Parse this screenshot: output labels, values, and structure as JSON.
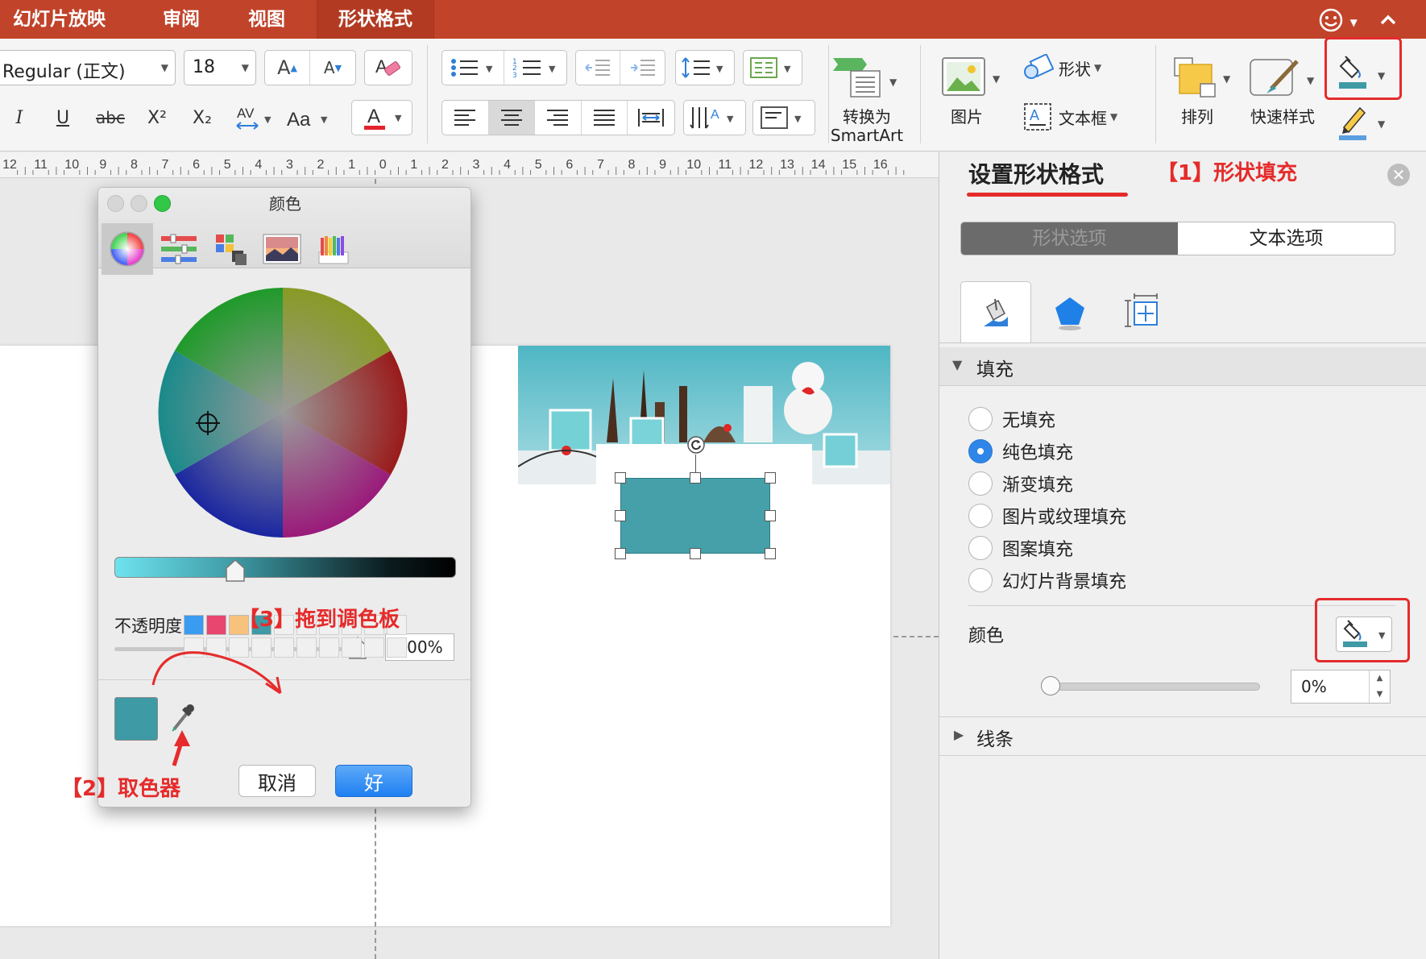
{
  "tabs": [
    {
      "label": "幻灯片放映",
      "active": false
    },
    {
      "label": "审阅",
      "active": false
    },
    {
      "label": "视图",
      "active": false
    },
    {
      "label": "形状格式",
      "active": true
    }
  ],
  "ribbon": {
    "font_name": "Regular (正文)",
    "font_size": "18",
    "convert_smartart": [
      "转换为",
      "SmartArt"
    ],
    "picture_label": "图片",
    "shape_label": "形状",
    "textbox_label": "文本框",
    "arrange_label": "排列",
    "quick_style_label": "快速样式",
    "format_labels": {
      "italic": "I",
      "underline": "U",
      "strike": "abc",
      "superscript": "X²",
      "subscript": "X₂"
    }
  },
  "ruler_ticks": [
    "12",
    "11",
    "10",
    "9",
    "8",
    "7",
    "6",
    "5",
    "4",
    "3",
    "2",
    "1",
    "0",
    "1",
    "2",
    "3",
    "4",
    "5",
    "6",
    "7",
    "8",
    "9",
    "10",
    "11",
    "12",
    "13",
    "14",
    "15",
    "16"
  ],
  "color_dialog": {
    "title": "颜色",
    "opacity_label": "不透明度",
    "opacity_value": "100%",
    "current_color": "#3e9aa5",
    "custom_swatches": [
      "#3a9cf0",
      "#e8466e",
      "#f7c27c",
      "#3e9aa5"
    ],
    "cancel_label": "取消",
    "ok_label": "好"
  },
  "selected_shape": {
    "fill_color": "#46a0aa"
  },
  "format_pane": {
    "title": "设置形状格式",
    "tabs": [
      "形状选项",
      "文本选项"
    ],
    "fill_section": "填充",
    "fill_options": [
      {
        "label": "无填充",
        "selected": false
      },
      {
        "label": "纯色填充",
        "selected": true
      },
      {
        "label": "渐变填充",
        "selected": false
      },
      {
        "label": "图片或纹理填充",
        "selected": false
      },
      {
        "label": "图案填充",
        "selected": false
      },
      {
        "label": "幻灯片背景填充",
        "selected": false
      }
    ],
    "color_label": "颜色",
    "transparency_value": "0%",
    "line_section": "线条"
  },
  "annotations": {
    "a1": "【1】形状填充",
    "a2": "【2】取色器",
    "a3": "【3】拖到调色板"
  }
}
